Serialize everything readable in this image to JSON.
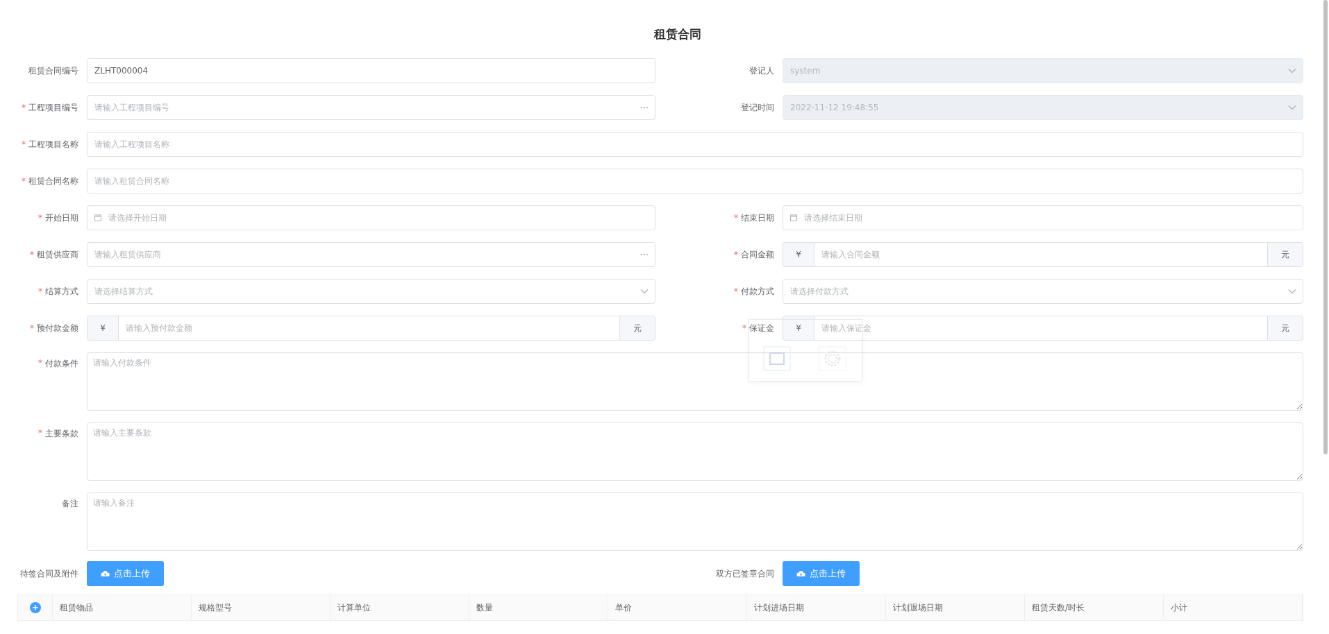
{
  "title": "租赁合同",
  "rows": [
    [
      {
        "label": "租赁合同编号",
        "kind": "text",
        "value": "ZLHT000004",
        "disabled": false
      },
      {
        "label": "登记人",
        "kind": "select",
        "value": "system",
        "disabled": true
      }
    ],
    [
      {
        "mark": "*",
        "label": "工程项目编号",
        "kind": "lookup",
        "placeholder": "请输入工程项目编号",
        "disabled": false
      },
      {
        "label": "登记时间",
        "kind": "select",
        "value": "2022-11-12 19:48:55",
        "disabled": true
      }
    ],
    [
      {
        "mark": "*",
        "label": "工程项目名称",
        "kind": "text",
        "placeholder": "请输入工程项目名称",
        "disabled": false
      }
    ],
    [
      {
        "mark": "*",
        "label": "租赁合同名称",
        "kind": "text",
        "placeholder": "请输入租赁合同名称",
        "disabled": false
      }
    ],
    [
      {
        "mark": "*",
        "label": "开始日期",
        "kind": "date",
        "placeholder": "请选择开始日期",
        "disabled": false
      },
      {
        "mark": "*",
        "label": "结束日期",
        "kind": "date",
        "placeholder": "请选择结束日期",
        "disabled": false
      }
    ],
    [
      {
        "mark": "*",
        "label": "租赁供应商",
        "kind": "lookup",
        "placeholder": "请输入租赁供应商",
        "disabled": false
      },
      {
        "mark": "*",
        "label": "合同金额",
        "kind": "money",
        "prefix": "¥",
        "suffix": "元",
        "placeholder": "请输入合同金额",
        "disabled": false
      }
    ],
    [
      {
        "mark": "*",
        "label": "结算方式",
        "kind": "select",
        "placeholder": "请选择结算方式",
        "disabled": false
      },
      {
        "mark": "*",
        "label": "付款方式",
        "kind": "select",
        "placeholder": "请选择付款方式",
        "disabled": false
      }
    ],
    [
      {
        "mark": "*",
        "label": "预付款金额",
        "kind": "money",
        "prefix": "¥",
        "suffix": "元",
        "placeholder": "请输入预付款金额",
        "disabled": false
      },
      {
        "mark": "*",
        "label": "保证金",
        "kind": "money",
        "prefix": "¥",
        "suffix": "元",
        "placeholder": "请输入保证金",
        "disabled": false
      }
    ],
    [
      {
        "mark": "*",
        "label": "付款条件",
        "kind": "textarea",
        "placeholder": "请输入付款条件",
        "disabled": false
      }
    ],
    [
      {
        "mark": "*",
        "label": "主要条款",
        "kind": "textarea",
        "placeholder": "请输入主要条款",
        "disabled": false
      }
    ],
    [
      {
        "label": "备注",
        "kind": "textarea",
        "placeholder": "请输入备注",
        "disabled": false
      }
    ]
  ],
  "uploads": [
    {
      "label": "待签合同及附件",
      "button": "点击上传"
    },
    {
      "label": "双方已签章合同",
      "button": "点击上传"
    }
  ],
  "table": {
    "columns": [
      "租赁物品",
      "规格型号",
      "计算单位",
      "数量",
      "单价",
      "计划进场日期",
      "计划退场日期",
      "租赁天数/时长",
      "小计"
    ]
  }
}
